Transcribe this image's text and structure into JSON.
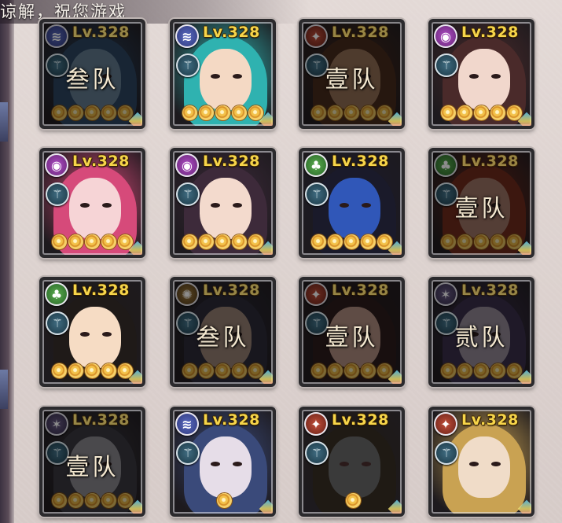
{
  "notice": "谅解，祝您游戏",
  "cards": [
    {
      "level": "Lv.328",
      "element": "water",
      "team": "叁队",
      "stars": 5,
      "skin": "#6a8ba3",
      "hair": "#2b4a6c"
    },
    {
      "level": "Lv.328",
      "element": "water",
      "team": "",
      "stars": 5,
      "skin": "#f4d9c4",
      "hair": "#2fb2b0"
    },
    {
      "level": "Lv.328",
      "element": "fire",
      "team": "壹队",
      "stars": 0,
      "skin": "#a37a5c",
      "hair": "#4a2a1a"
    },
    {
      "level": "Lv.328",
      "element": "spirit",
      "team": "",
      "stars": 5,
      "skin": "#f1d7cc",
      "hair": "#4a2a2a"
    },
    {
      "level": "Lv.328",
      "element": "spirit",
      "team": "",
      "stars": 5,
      "skin": "#f6d4d6",
      "hair": "#d64a7a"
    },
    {
      "level": "Lv.328",
      "element": "spirit",
      "team": "",
      "stars": 5,
      "skin": "#f3dacd",
      "hair": "#3d2a3a"
    },
    {
      "level": "Lv.328",
      "element": "wood",
      "team": "",
      "stars": 5,
      "skin": "#3057b8",
      "hair": "#1a1a2a"
    },
    {
      "level": "Lv.328",
      "element": "wood",
      "team": "壹队",
      "stars": 0,
      "skin": "#b08070",
      "hair": "#7a2a1a"
    },
    {
      "level": "Lv.328",
      "element": "wood",
      "team": "",
      "stars": 5,
      "skin": "#f6dcc4",
      "hair": "#1f1a18"
    },
    {
      "level": "Lv.328",
      "element": "gold",
      "team": "叁队",
      "stars": 0,
      "skin": "#a89080",
      "hair": "#2a2a3a"
    },
    {
      "level": "Lv.328",
      "element": "fire",
      "team": "壹队",
      "stars": 0,
      "skin": "#c8a090",
      "hair": "#2a1a1a"
    },
    {
      "level": "Lv.328",
      "element": "dark",
      "team": "贰队",
      "stars": 0,
      "skin": "#a49aa8",
      "hair": "#3a3050"
    },
    {
      "level": "Lv.328",
      "element": "dark",
      "team": "壹队",
      "stars": 0,
      "skin": "#9a9aa0",
      "hair": "#3a3a44"
    },
    {
      "level": "Lv.328",
      "element": "water",
      "team": "",
      "stars": 1,
      "skin": "#e6dde8",
      "hair": "#3a4a7a"
    },
    {
      "level": "Lv.328",
      "element": "fire",
      "team": "",
      "stars": 1,
      "skin": "#3a3a3a",
      "hair": "#1f1a14"
    },
    {
      "level": "Lv.328",
      "element": "fire",
      "team": "",
      "stars": 0,
      "skin": "#f0dcc8",
      "hair": "#c9a252"
    }
  ],
  "icons": {
    "element_water": "≋",
    "element_fire": "✦",
    "element_spirit": "◉",
    "element_wood": "♣",
    "element_dark": "✶",
    "element_gold": "✺",
    "skill": "⚚"
  }
}
